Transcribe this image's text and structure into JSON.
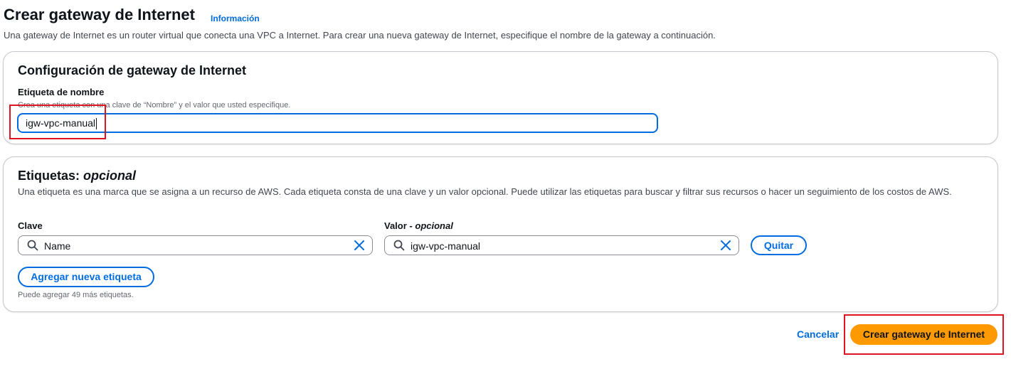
{
  "header": {
    "title": "Crear gateway de Internet",
    "info_link": "Información",
    "description": "Una gateway de Internet es un router virtual que conecta una VPC a Internet. Para crear una nueva gateway de Internet, especifique el nombre de la gateway a continuación."
  },
  "config_section": {
    "title": "Configuración de gateway de Internet",
    "name_tag_label": "Etiqueta de nombre",
    "name_tag_hint": "Crea una etiqueta con una clave de “Nombre” y el valor que usted especifique.",
    "name_tag_value": "igw-vpc-manual"
  },
  "tags_section": {
    "title_main": "Etiquetas:",
    "title_optional": "opcional",
    "description": "Una etiqueta es una marca que se asigna a un recurso de AWS. Cada etiqueta consta de una clave y un valor opcional. Puede utilizar las etiquetas para buscar y filtrar sus recursos o hacer un seguimiento de los costos de AWS.",
    "key_label": "Clave",
    "value_label_main": "Valor -",
    "value_label_optional": "opcional",
    "tags": [
      {
        "key": "Name",
        "value": "igw-vpc-manual"
      }
    ],
    "remove_button": "Quitar",
    "add_button": "Agregar nueva etiqueta",
    "limit_note": "Puede agregar 49 más etiquetas."
  },
  "footer": {
    "cancel_label": "Cancelar",
    "create_label": "Crear gateway de Internet"
  },
  "colors": {
    "accent": "#006ce0",
    "primary_button": "#ff9900",
    "highlight": "#e0141e"
  },
  "icons": {
    "search": "search-icon",
    "clear": "close-icon"
  }
}
